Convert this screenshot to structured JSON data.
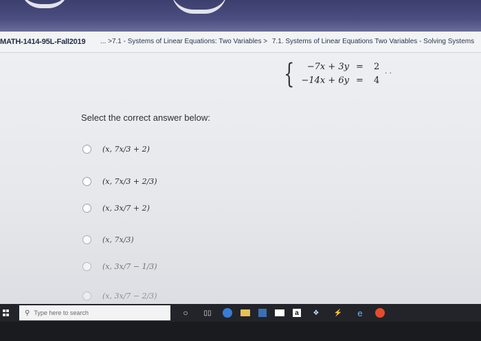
{
  "header": {
    "course": "MATH-1414-95L-Fall2019",
    "breadcrumb": [
      "... >7.1 - Systems of Linear Equations: Two Variables >",
      "7.1. Systems of Linear Equations Two Variables - Solving Systems"
    ]
  },
  "system": {
    "eq1": {
      "lhs": "−7x + 3y",
      "eq": "=",
      "rhs": "2"
    },
    "eq2": {
      "lhs": "−14x + 6y",
      "eq": "=",
      "rhs": "4"
    },
    "trail": ". ."
  },
  "question": {
    "prompt": "Select the correct answer below:",
    "options": [
      {
        "label": "(x, 7x/3 + 2)"
      },
      {
        "label": "(x, 7x/3 + 2/3)"
      },
      {
        "label": "(x, 3x/7 + 2)"
      },
      {
        "label": "(x, 7x/3)"
      },
      {
        "label": "(x, 3x/7 − 1/3)"
      },
      {
        "label": "(x, 3x/7 − 2/3)"
      }
    ]
  },
  "taskbar": {
    "search_placeholder": "Type here to search",
    "icons": [
      "windows-icon",
      "search-icon",
      "cortana-icon",
      "task-view-icon",
      "edge-icon",
      "file-explorer-icon",
      "store-icon",
      "mail-icon",
      "amazon-icon",
      "dropbox-icon",
      "winamp-icon",
      "ie-icon",
      "office-icon"
    ],
    "amazon_label": "a"
  }
}
